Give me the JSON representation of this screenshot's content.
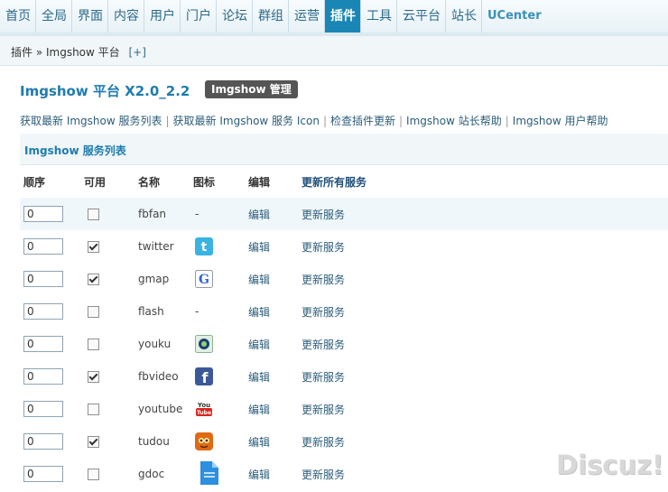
{
  "nav": {
    "tabs": [
      "首页",
      "全局",
      "界面",
      "内容",
      "用户",
      "门户",
      "论坛",
      "群组",
      "运营",
      "插件",
      "工具",
      "云平台",
      "站长",
      "UCenter"
    ],
    "active_index": 9
  },
  "breadcrumb": {
    "text": "插件 » Imgshow 平台",
    "plus": "[+]"
  },
  "heading": {
    "title": "Imgshow 平台 X2.0_2.2",
    "badge": "Imgshow 管理"
  },
  "links": [
    "获取最新 Imgshow 服务列表",
    "获取最新 Imgshow 服务 Icon",
    "检查插件更新",
    "Imgshow 站长帮助",
    "Imgshow 用户帮助"
  ],
  "section_title": "Imgshow 服务列表",
  "columns": {
    "order": "顺序",
    "available": "可用",
    "name": "名称",
    "icon": "图标",
    "edit": "编辑",
    "update_all": "更新所有服务"
  },
  "rows": [
    {
      "order": "0",
      "enabled": false,
      "name": "fbfan",
      "icon": "none",
      "icon_text": "-",
      "edit": "编辑",
      "update": "更新服务"
    },
    {
      "order": "0",
      "enabled": true,
      "name": "twitter",
      "icon": "twitter-icon",
      "edit": "编辑",
      "update": "更新服务"
    },
    {
      "order": "0",
      "enabled": true,
      "name": "gmap",
      "icon": "google-icon",
      "edit": "编辑",
      "update": "更新服务"
    },
    {
      "order": "0",
      "enabled": false,
      "name": "flash",
      "icon": "none",
      "icon_text": "-",
      "edit": "编辑",
      "update": "更新服务"
    },
    {
      "order": "0",
      "enabled": false,
      "name": "youku",
      "icon": "youku-icon",
      "edit": "编辑",
      "update": "更新服务"
    },
    {
      "order": "0",
      "enabled": true,
      "name": "fbvideo",
      "icon": "facebook-icon",
      "edit": "编辑",
      "update": "更新服务"
    },
    {
      "order": "0",
      "enabled": false,
      "name": "youtube",
      "icon": "youtube-icon",
      "edit": "编辑",
      "update": "更新服务"
    },
    {
      "order": "0",
      "enabled": true,
      "name": "tudou",
      "icon": "tudou-icon",
      "edit": "编辑",
      "update": "更新服务"
    },
    {
      "order": "0",
      "enabled": false,
      "name": "gdoc",
      "icon": "gdoc-icon",
      "edit": "编辑",
      "update": "更新服务"
    }
  ],
  "watermark": "Discuz!"
}
